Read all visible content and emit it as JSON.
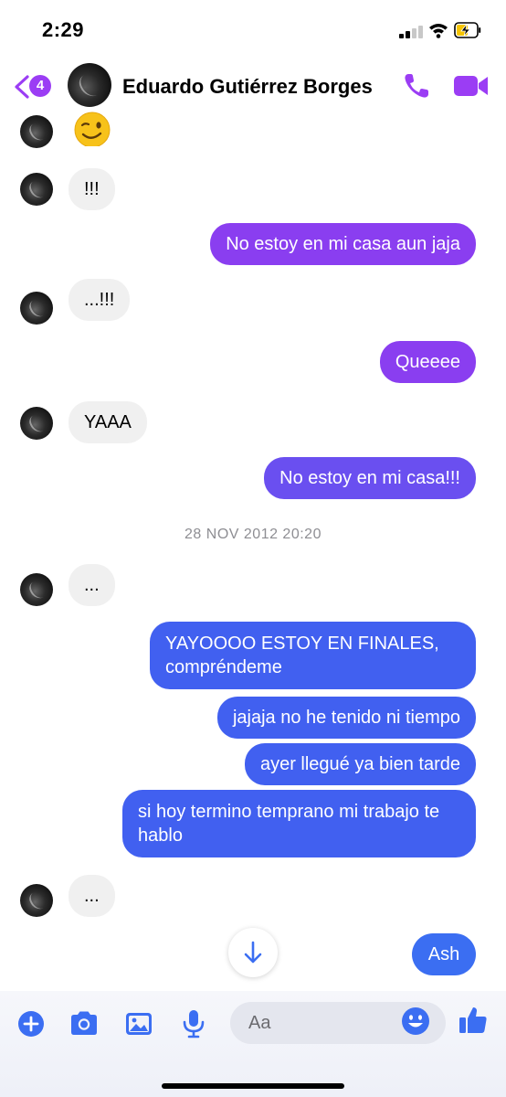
{
  "status_bar": {
    "time": "2:29"
  },
  "header": {
    "back_badge_count": "4",
    "contact_name": "Eduardo Gutiérrez Borges"
  },
  "messages": [
    {
      "from": "contact",
      "text": ""
    },
    {
      "from": "contact",
      "text": "!!!"
    },
    {
      "from": "me",
      "text": "No estoy en mi casa aun jaja"
    },
    {
      "from": "contact",
      "text": "...!!!"
    },
    {
      "from": "me",
      "text": "Queeee"
    },
    {
      "from": "contact",
      "text": "YAAA"
    },
    {
      "from": "me",
      "text": "No estoy en mi casa!!!"
    },
    {
      "from": "system",
      "text": "28 NOV 2012 20:20"
    },
    {
      "from": "contact",
      "text": "..."
    },
    {
      "from": "me",
      "text": "YAYOOOO ESTOY EN FINALES, compréndeme"
    },
    {
      "from": "me",
      "text": "jajaja no he tenido ni tiempo"
    },
    {
      "from": "me",
      "text": "ayer llegué ya bien tarde"
    },
    {
      "from": "me",
      "text": "si hoy termino temprano mi trabajo te hablo"
    },
    {
      "from": "contact",
      "text": "..."
    }
  ],
  "quick_reply": {
    "label": "Ash"
  },
  "composer": {
    "placeholder": "Aa",
    "icons": [
      "plus-icon",
      "camera-icon",
      "image-icon",
      "microphone-icon",
      "emoji-icon",
      "thumbs-up-icon"
    ]
  },
  "colors": {
    "accent": "#9b3df4",
    "bubble_purple": "#8a3ef0",
    "bubble_violet": "#6a4ff0",
    "bubble_blue": "#4160f0",
    "incoming_bubble": "#f0f0f0",
    "composer_icon": "#3b6ef2"
  }
}
